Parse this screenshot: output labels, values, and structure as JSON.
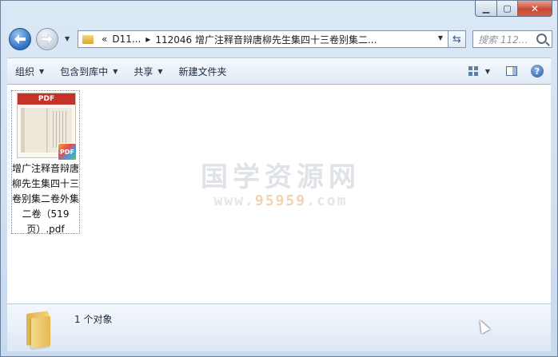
{
  "window": {
    "minimize_label": "▁",
    "maximize_label": "▢",
    "close_label": "✕"
  },
  "nav": {
    "breadcrumb_prefix": "«",
    "breadcrumb_root": "D11...",
    "breadcrumb_sep": "▸",
    "breadcrumb_current": "112046 增广注释音辩唐柳先生集四十三卷别集二...",
    "search_placeholder": "搜索 112..."
  },
  "toolbar": {
    "organize": "组织",
    "include_library": "包含到库中",
    "share": "共享",
    "new_folder": "新建文件夹"
  },
  "files": [
    {
      "name": "增广注释音辩唐柳先生集四十三卷别集二卷外集二卷（519页）.pdf",
      "thumb_label": "PDF",
      "badge": "PDF"
    }
  ],
  "watermark": {
    "title": "国学资源网",
    "url_prefix": "www.",
    "url_number": "95959",
    "url_suffix": ".com"
  },
  "details": {
    "count_text": "1 个对象"
  },
  "colors": {
    "close_button": "#c74a36",
    "accent": "#2d6fc0"
  }
}
